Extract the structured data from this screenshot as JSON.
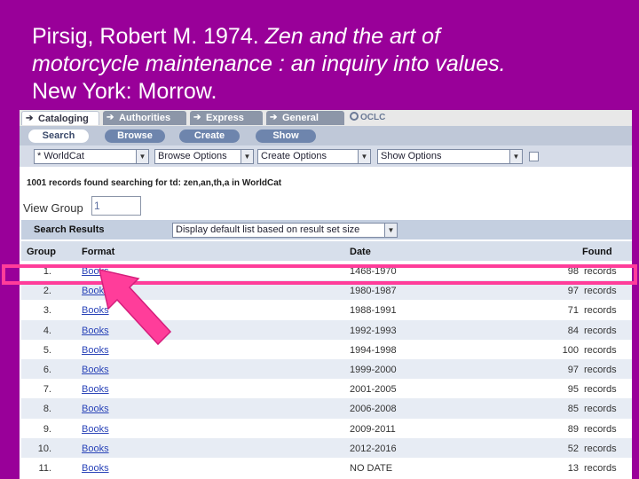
{
  "slide": {
    "title_line1_prefix": "Pirsig, Robert M. 1974. ",
    "title_line1_em": "Zen and the art of",
    "title_line2_em": "motorcycle maintenance : an inquiry into values.",
    "title_line3": "New York: Morrow."
  },
  "tabs": [
    "Cataloging",
    "Authorities",
    "Express",
    "General"
  ],
  "oclc_logo": "OCLC",
  "subnav": [
    "Search",
    "Browse",
    "Create",
    "Show"
  ],
  "selects": {
    "database": "* WorldCat",
    "browse": "Browse Options",
    "create": "Create Options",
    "show": "Show Options"
  },
  "records_found": "1001 records found searching for td: zen,an,th,a in WorldCat",
  "view_group": {
    "label": "View Group",
    "value": "1"
  },
  "results": {
    "label": "Search Results",
    "display_option": "Display default list based on result set size"
  },
  "columns": {
    "group": "Group",
    "format": "Format",
    "date": "Date",
    "found": "Found"
  },
  "rows": [
    {
      "group": "1.",
      "format": "Books",
      "date": "1468-1970",
      "count": "98",
      "unit": "records"
    },
    {
      "group": "2.",
      "format": "Books",
      "date": "1980-1987",
      "count": "97",
      "unit": "records"
    },
    {
      "group": "3.",
      "format": "Books",
      "date": "1988-1991",
      "count": "71",
      "unit": "records"
    },
    {
      "group": "4.",
      "format": "Books",
      "date": "1992-1993",
      "count": "84",
      "unit": "records"
    },
    {
      "group": "5.",
      "format": "Books",
      "date": "1994-1998",
      "count": "100",
      "unit": "records"
    },
    {
      "group": "6.",
      "format": "Books",
      "date": "1999-2000",
      "count": "97",
      "unit": "records"
    },
    {
      "group": "7.",
      "format": "Books",
      "date": "2001-2005",
      "count": "95",
      "unit": "records"
    },
    {
      "group": "8.",
      "format": "Books",
      "date": "2006-2008",
      "count": "85",
      "unit": "records"
    },
    {
      "group": "9.",
      "format": "Books",
      "date": "2009-2011",
      "count": "89",
      "unit": "records"
    },
    {
      "group": "10.",
      "format": "Books",
      "date": "2012-2016",
      "count": "52",
      "unit": "records"
    },
    {
      "group": "11.",
      "format": "Books",
      "date": "NO DATE",
      "count": "13",
      "unit": "records"
    }
  ],
  "colors": {
    "background": "#990099",
    "highlight": "#ff3d9a"
  }
}
